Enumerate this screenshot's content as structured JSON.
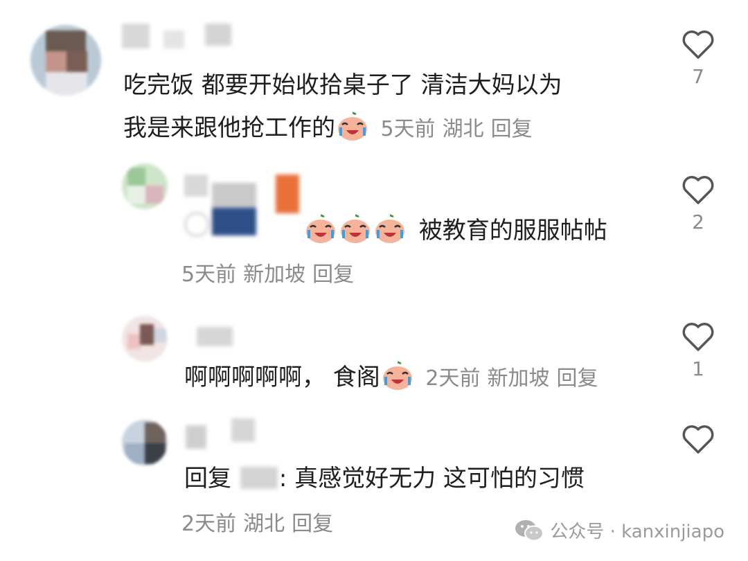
{
  "comments": [
    {
      "text_line1": "吃完饭 都要开始收拾桌子了 清洁大妈以为",
      "text_line2": "我是来跟他抢工作的",
      "time": "5天前",
      "location": "湖北",
      "reply": "回复",
      "likes": "7"
    },
    {
      "text": "被教育的服服帖帖",
      "time": "5天前",
      "location": "新加坡",
      "reply": "回复",
      "likes": "2"
    },
    {
      "text": "啊啊啊啊啊， 食阁",
      "time": "2天前",
      "location": "新加坡",
      "reply": "回复",
      "likes": "1"
    },
    {
      "reply_prefix": "回复",
      "text": "真感觉好无力 这可怕的习惯",
      "time": "2天前",
      "location": "湖北",
      "reply": "回复"
    }
  ],
  "watermark": {
    "text": "公众号 · kanxinjiapo"
  },
  "icons": {
    "like": "heart-outline-icon",
    "emoji": "crying-face-emoji-icon",
    "watermark": "wechat-icon"
  },
  "colors": {
    "text": "#1e1e1e",
    "meta": "#8a8a8a",
    "heart": "#555555"
  }
}
